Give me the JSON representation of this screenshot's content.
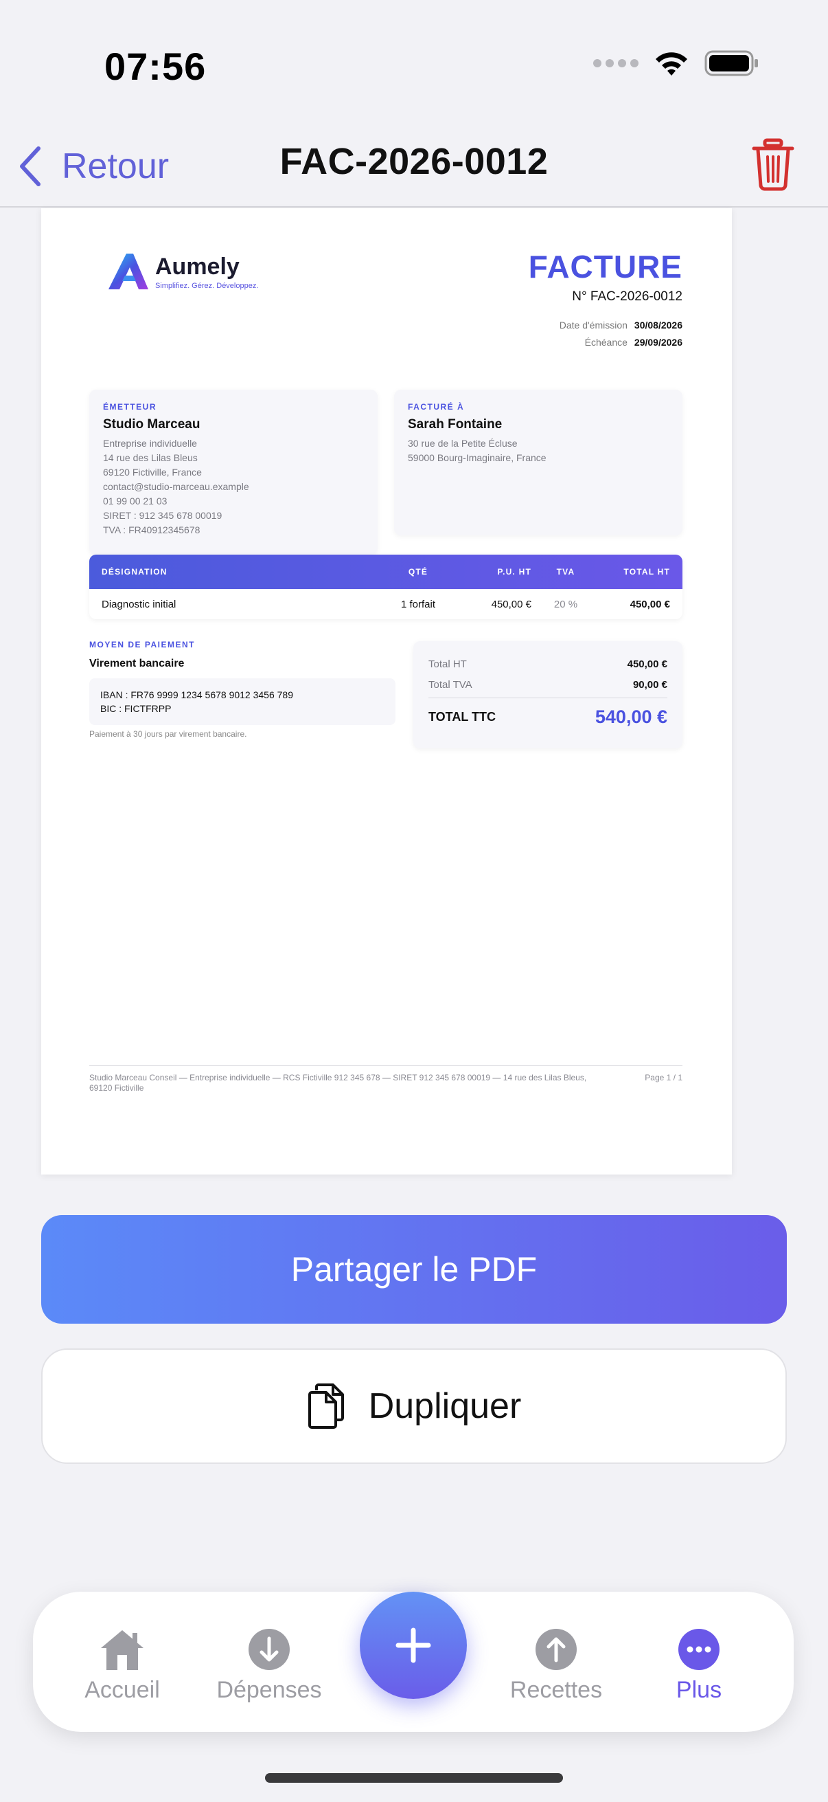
{
  "status_bar": {
    "time": "07:56"
  },
  "nav": {
    "back_label": "Retour",
    "title": "FAC-2026-0012"
  },
  "invoice": {
    "brand": {
      "name": "Aumely",
      "tagline": "Simplifiez. Gérez. Développez."
    },
    "heading": "FACTURE",
    "number": "N° FAC-2026-0012",
    "issue_date_label": "Date d'émission",
    "issue_date": "30/08/2026",
    "due_date_label": "Échéance",
    "due_date": "29/09/2026",
    "emitter": {
      "label": "ÉMETTEUR",
      "name": "Studio Marceau",
      "lines": [
        "Entreprise individuelle",
        "14 rue des Lilas Bleus",
        "69120 Fictiville, France",
        "contact@studio-marceau.example",
        "01 99 00 21 03",
        "SIRET : 912 345 678 00019",
        "TVA : FR40912345678"
      ]
    },
    "billed_to": {
      "label": "FACTURÉ À",
      "name": "Sarah Fontaine",
      "lines": [
        "30 rue de la Petite Écluse",
        "59000 Bourg-Imaginaire, France"
      ]
    },
    "table": {
      "headers": {
        "designation": "DÉSIGNATION",
        "qty": "QTÉ",
        "unit_price": "P.U. HT",
        "vat": "TVA",
        "total": "TOTAL HT"
      },
      "rows": [
        {
          "designation": "Diagnostic initial",
          "qty": "1 forfait",
          "unit_price": "450,00 €",
          "vat": "20 %",
          "total": "450,00 €"
        }
      ]
    },
    "payment": {
      "label": "MOYEN DE PAIEMENT",
      "method": "Virement bancaire",
      "iban": "IBAN : FR76 9999 1234 5678 9012 3456 789",
      "bic": "BIC : FICTFRPP",
      "note": "Paiement à 30 jours par virement bancaire."
    },
    "totals": {
      "ht_label": "Total HT",
      "ht": "450,00 €",
      "tva_label": "Total TVA",
      "tva": "90,00 €",
      "ttc_label": "TOTAL TTC",
      "ttc": "540,00 €"
    },
    "footer": {
      "legal": "Studio Marceau Conseil — Entreprise individuelle — RCS Fictiville 912 345 678 — SIRET 912 345 678 00019 — 14 rue des Lilas Bleus, 69120 Fictiville",
      "page": "Page 1 / 1"
    }
  },
  "actions": {
    "share_label": "Partager le PDF",
    "duplicate_label": "Dupliquer"
  },
  "tab_bar": {
    "home": "Accueil",
    "expenses": "Dépenses",
    "income": "Recettes",
    "more": "Plus",
    "active": "more"
  },
  "colors": {
    "accent": "#6a58e8",
    "brand_blue": "#4a52e0",
    "danger": "#d3312f"
  },
  "icons": [
    "back-chevron-icon",
    "trash-icon",
    "copy-icon",
    "home-icon",
    "arrow-down-circle-icon",
    "plus-icon",
    "arrow-up-circle-icon",
    "more-dots-icon",
    "wifi-icon",
    "battery-icon"
  ]
}
